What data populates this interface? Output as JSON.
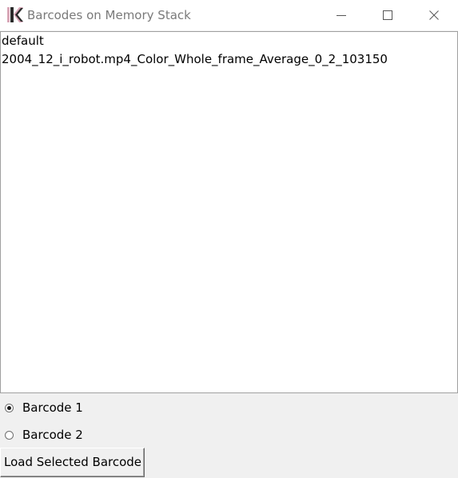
{
  "window": {
    "title": "Barcodes on Memory Stack",
    "controls": {
      "minimize_icon": "minimize-icon",
      "maximize_icon": "maximize-icon",
      "close_icon": "close-icon"
    },
    "app_icon": "app-logo-icon"
  },
  "listbox": {
    "items": [
      "default",
      "2004_12_i_robot.mp4_Color_Whole_frame_Average_0_2_103150"
    ]
  },
  "options": {
    "radio": [
      {
        "label": "Barcode 1",
        "checked": true
      },
      {
        "label": "Barcode 2",
        "checked": false
      }
    ]
  },
  "actions": {
    "load_label": "Load Selected Barcode"
  },
  "colors": {
    "titlebar_bg": "#ffffff",
    "window_bg": "#f0f0f0",
    "title_text": "#7a7a7a",
    "logo_light": "#d9a8b8",
    "logo_dark": "#2b2b2b"
  }
}
